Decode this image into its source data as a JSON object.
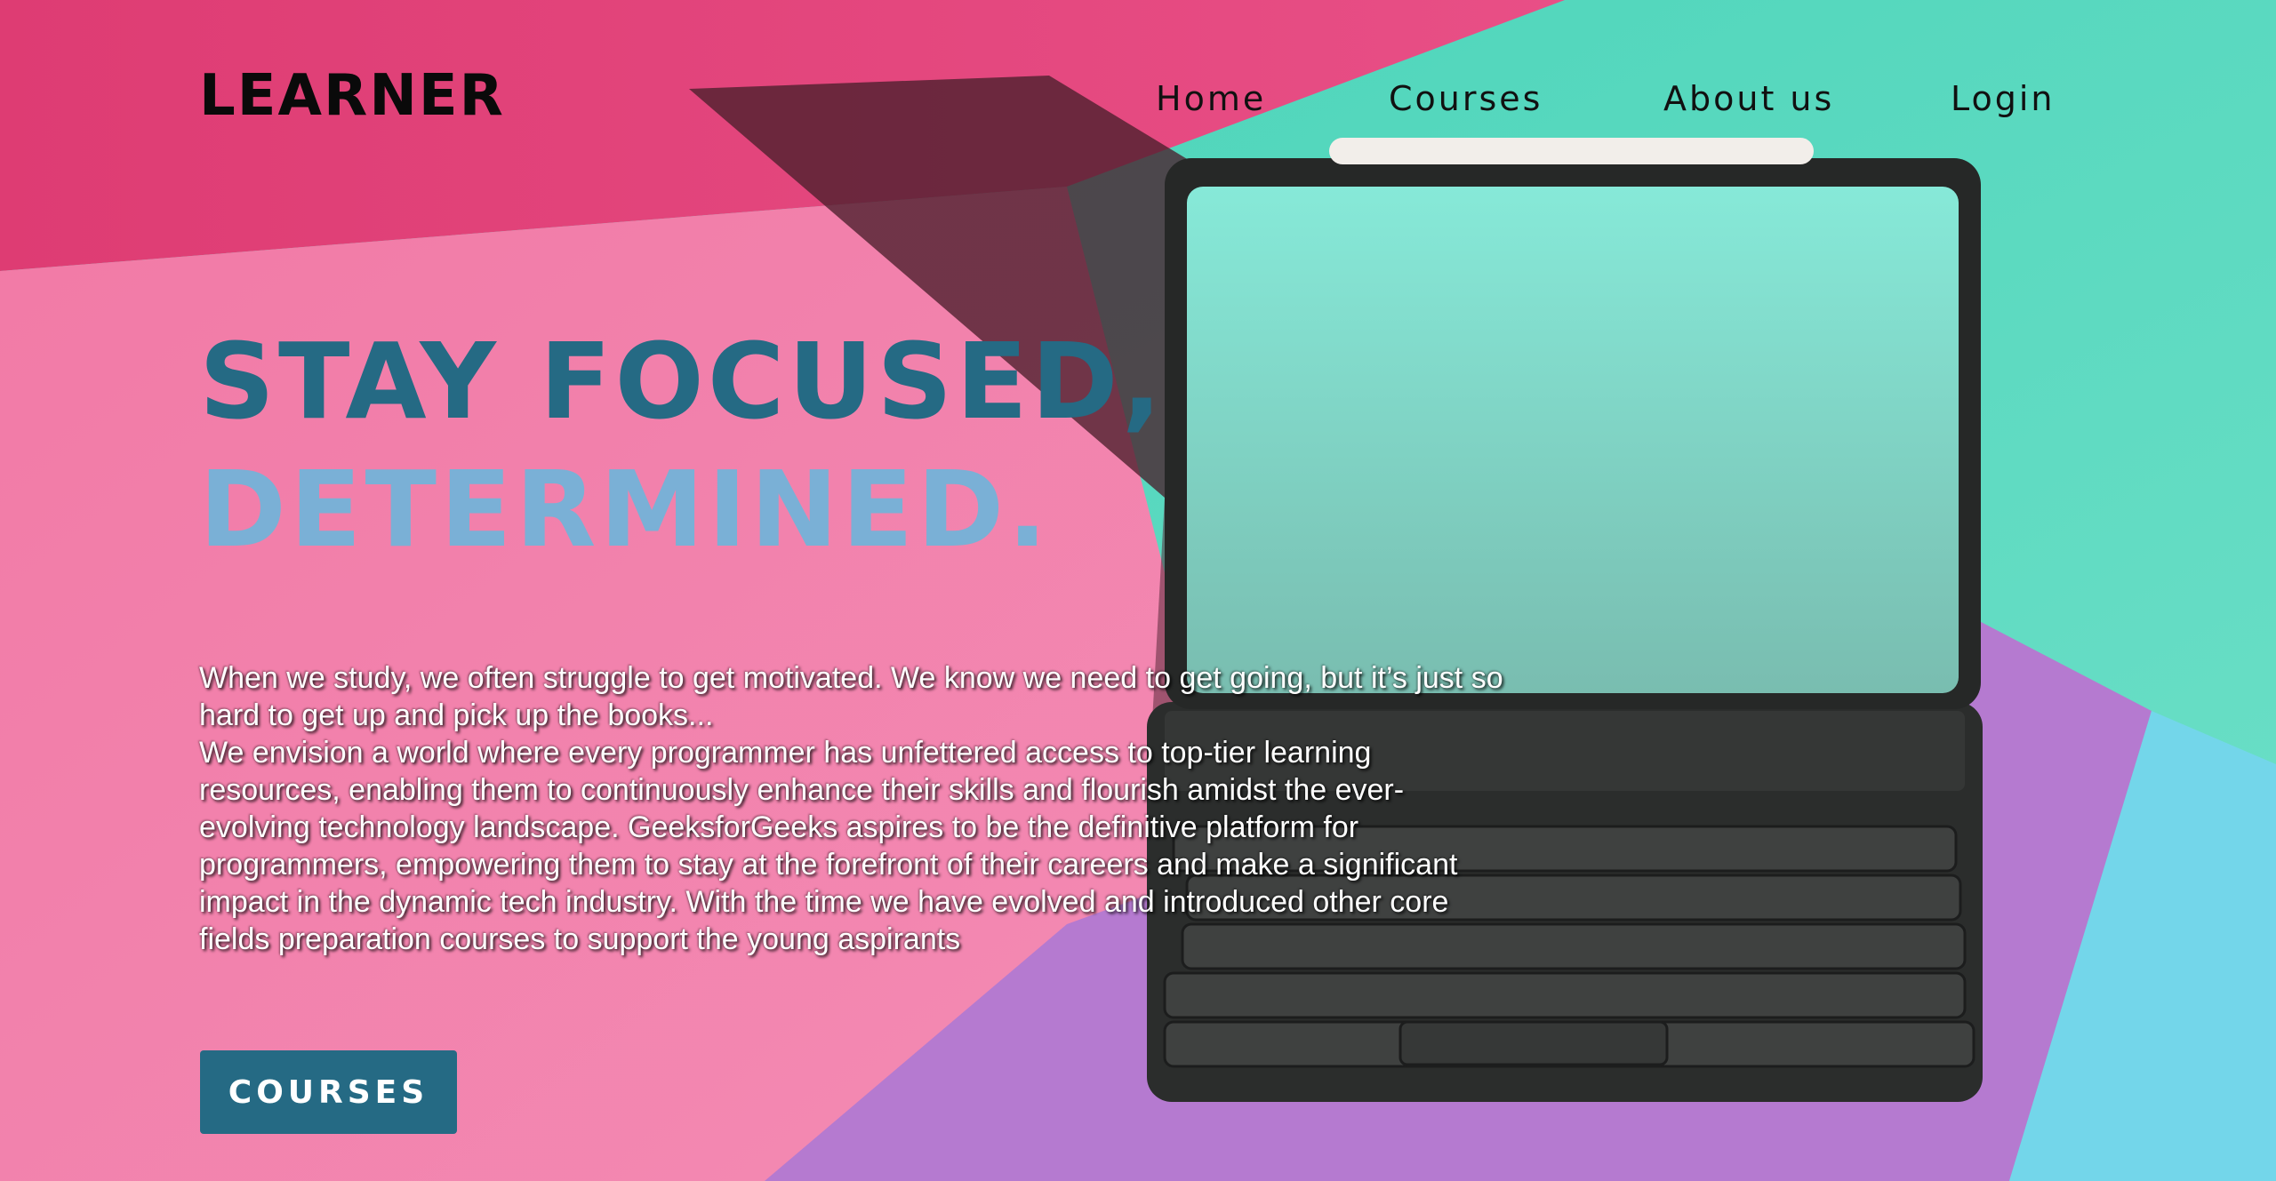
{
  "brand": {
    "logo_text": "LEARNER"
  },
  "nav": {
    "items": [
      {
        "label": "Home"
      },
      {
        "label": "Courses"
      },
      {
        "label": "About us"
      },
      {
        "label": "Login"
      }
    ]
  },
  "hero": {
    "headline_line1": "STAY FOCUSED,",
    "headline_line2": "DETERMINED.",
    "paragraph1": "When we study, we often struggle to get motivated. We know we need to get going, but it’s just so hard to get up and pick up the books...",
    "paragraph2": "We envision a world where every programmer has unfettered access to top-tier learning resources, enabling them to continuously enhance their skills and flourish amidst the ever-evolving technology landscape. GeeksforGeeks aspires to be the definitive platform for programmers, empowering them to stay at the forefront of their careers and make a significant impact in the dynamic tech industry. With the time we have evolved and introduced other core fields preparation courses to support the young aspirants",
    "cta_label": "COURSES",
    "background_image": "tablet-keyboard-on-colorful-paper"
  },
  "colors": {
    "accent": "#256a84",
    "headline_secondary": "#7ab0d6",
    "pink": "#f07aa6",
    "teal": "#5fdcc4",
    "purple": "#b278cc",
    "cyan": "#72d8ea"
  }
}
